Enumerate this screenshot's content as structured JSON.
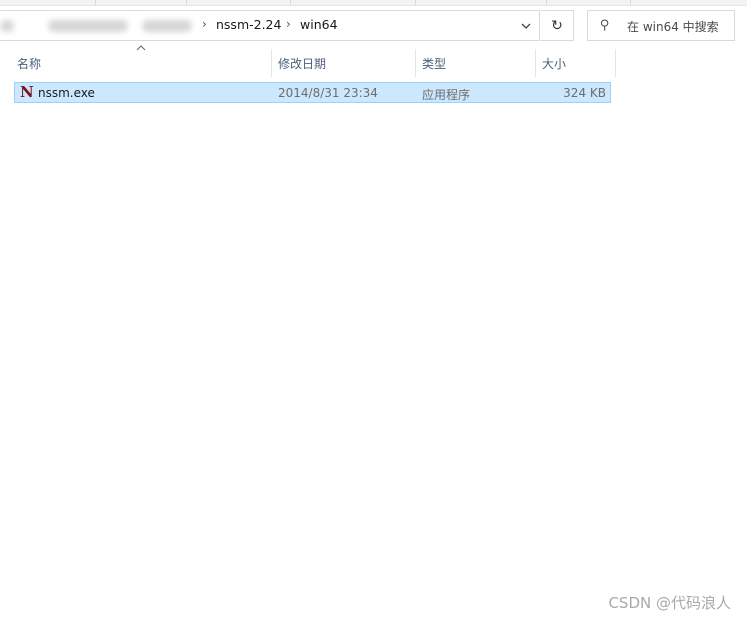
{
  "address_bar": {
    "breadcrumbs": [
      "nssm-2.24",
      "win64"
    ],
    "separator": "›",
    "dropdown_icon": "chevron-down-icon",
    "refresh_icon": "refresh-icon"
  },
  "search": {
    "placeholder": "在 win64 中搜索",
    "icon": "search-icon"
  },
  "columns": {
    "name": "名称",
    "date": "修改日期",
    "type": "类型",
    "size": "大小"
  },
  "files": [
    {
      "name": "nssm.exe",
      "modified": "2014/8/31 23:34",
      "type": "应用程序",
      "size": "324 KB",
      "icon_glyph": "N",
      "icon": "nssm-app-icon",
      "selected": true
    }
  ],
  "watermark": "CSDN @代码浪人",
  "colors": {
    "selection_bg": "#cce8ff",
    "selection_border": "#99d1ff",
    "header_text": "#4c607a",
    "icon_color": "#7a1420"
  }
}
